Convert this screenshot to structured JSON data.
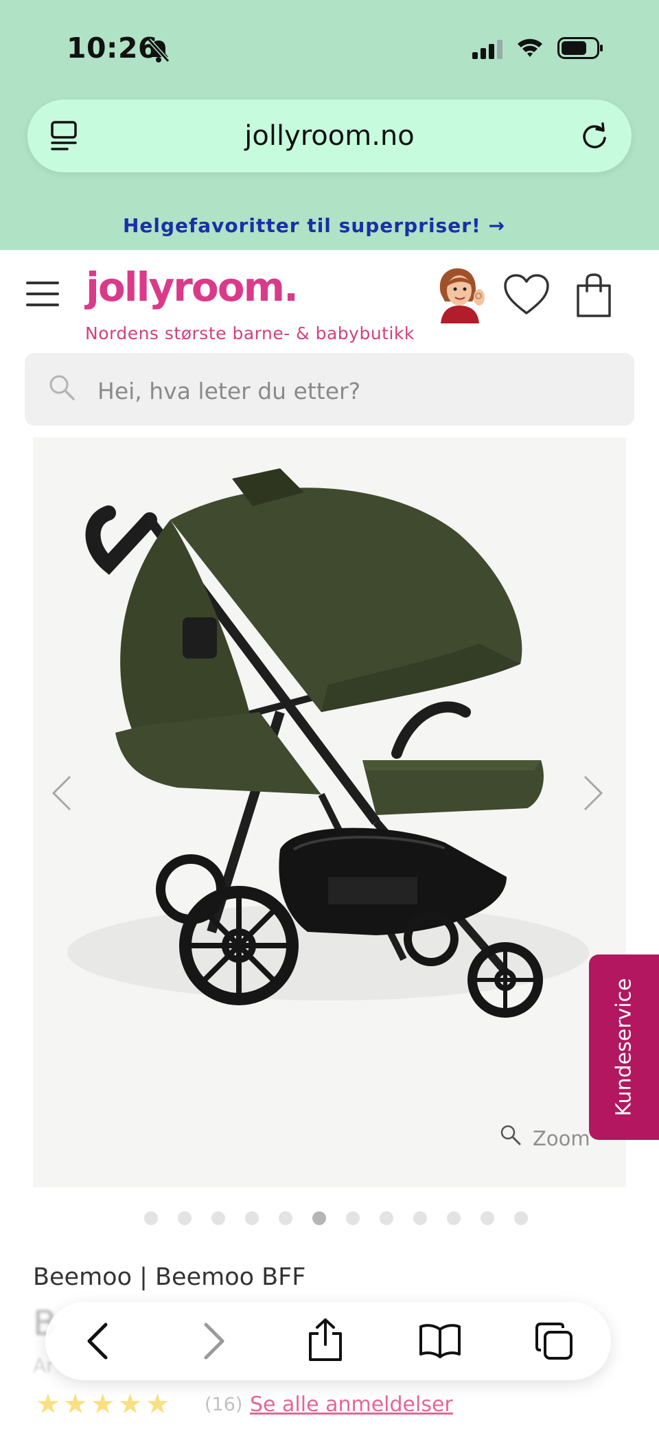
{
  "status_bar": {
    "time": "10:26"
  },
  "browser": {
    "url": "jollyroom.no"
  },
  "promo": {
    "text": "Helgefavoritter til superpriser! →"
  },
  "header": {
    "logo": "jollyroom.",
    "tagline": "Nordens største barne- & babybutikk"
  },
  "search": {
    "placeholder": "Hei, hva leter du etter?"
  },
  "gallery": {
    "zoom_label": "Zoom",
    "image_count": 12,
    "active_index": 5
  },
  "side_tab": {
    "label": "Kundeservice"
  },
  "product": {
    "brand": "Beemoo | Beemoo BFF",
    "name_fragment": "B",
    "article_prefix": "Ar",
    "rating_stars": 5,
    "review_count": "(16)",
    "reviews_link": "Se alle anmeldelser"
  },
  "colors": {
    "status_bg": "#b0e2c6",
    "urlbar_bg": "#c7fbdd",
    "brand_pink": "#d93b8a",
    "promo_blue": "#1a2fa8",
    "side_tab_bg": "#b3175f",
    "stroller_green": "#3f4a2e"
  },
  "icons": [
    "bell-slash-icon",
    "signal-icon",
    "wifi-icon",
    "battery-icon",
    "tabs-icon",
    "reload-icon",
    "hamburger-icon",
    "avatar-icon",
    "heart-icon",
    "bag-icon",
    "search-icon",
    "chevron-left-icon",
    "chevron-right-icon",
    "zoom-icon",
    "back-icon",
    "forward-icon",
    "share-icon",
    "bookmarks-icon",
    "tabs-overview-icon"
  ]
}
